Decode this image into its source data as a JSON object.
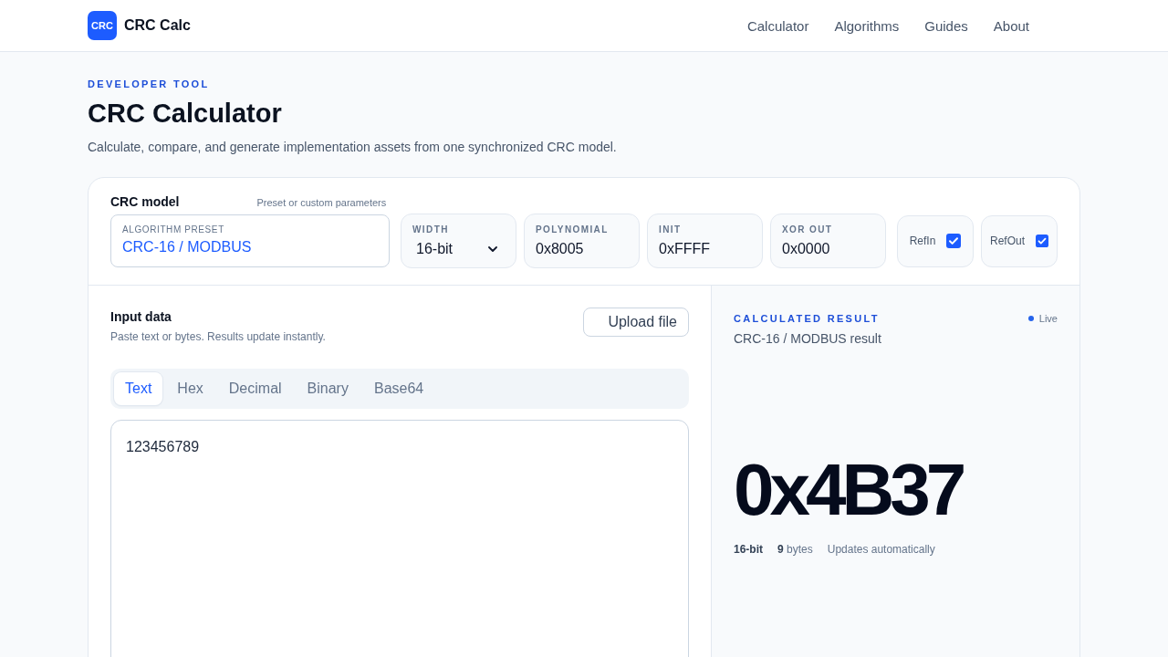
{
  "header": {
    "logo": "CRC",
    "brand": "CRC Calc",
    "nav": [
      {
        "label": "Calculator"
      },
      {
        "label": "Algorithms"
      },
      {
        "label": "Guides"
      },
      {
        "label": "About"
      }
    ]
  },
  "intro": {
    "eyebrow": "DEVELOPER TOOL",
    "title": "CRC Calculator",
    "subtitle": "Calculate, compare, and generate implementation assets from one synchronized CRC model."
  },
  "model": {
    "title": "CRC model",
    "hint": "Preset or custom parameters",
    "preset": {
      "label": "ALGORITHM PRESET",
      "value": "CRC-16 / MODBUS"
    },
    "fields": [
      {
        "kind": "select",
        "label": "WIDTH",
        "value": "16-bit"
      },
      {
        "kind": "text",
        "label": "POLYNOMIAL",
        "value": "0x8005"
      },
      {
        "kind": "text",
        "label": "INIT",
        "value": "0xFFFF"
      },
      {
        "kind": "text",
        "label": "XOR OUT",
        "value": "0x0000"
      }
    ],
    "toggles": [
      {
        "label": "RefIn",
        "checked": true
      },
      {
        "label": "RefOut",
        "checked": true
      }
    ]
  },
  "input": {
    "title": "Input data",
    "hint": "Paste text or bytes. Results update instantly.",
    "upload_button": "Upload file",
    "tabs": [
      {
        "label": "Text",
        "selected": true
      },
      {
        "label": "Hex",
        "selected": false
      },
      {
        "label": "Decimal",
        "selected": false
      },
      {
        "label": "Binary",
        "selected": false
      },
      {
        "label": "Base64",
        "selected": false
      }
    ],
    "value": "123456789"
  },
  "result": {
    "eyebrow": "CALCULATED RESULT",
    "status": "Live",
    "caption": "CRC-16 / MODBUS result",
    "value": "0x4B37",
    "width": "16-bit",
    "bytes": "**9** bytes",
    "note": "Updates automatically"
  }
}
